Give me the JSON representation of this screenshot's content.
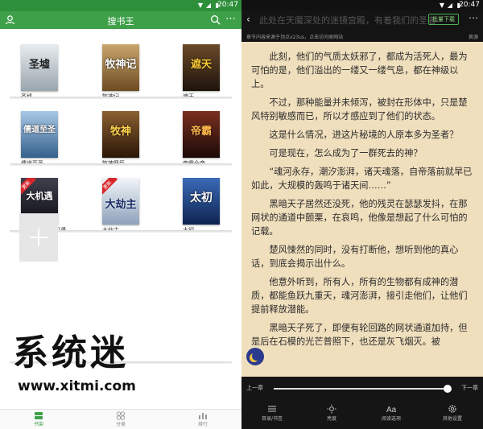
{
  "status": {
    "time": "20:47"
  },
  "left": {
    "app_title": "搜书王",
    "books": [
      {
        "name": "圣墟",
        "cover_title": "圣墟",
        "color": "#cfd6dc",
        "badge": ""
      },
      {
        "name": "牧神记",
        "cover_title": "牧神记",
        "color": "#8a6b3c",
        "badge": ""
      },
      {
        "name": "遮天",
        "cover_title": "遮天",
        "color": "#3a2a1a",
        "badge": ""
      },
      {
        "name": "儒道至圣",
        "cover_title": "儒道至圣",
        "color": "#5f8fb8",
        "badge": ""
      },
      {
        "name": "牧神祭臣",
        "cover_title": "牧神",
        "color": "#5a3a1e",
        "badge": ""
      },
      {
        "name": "帝霸全帝",
        "cover_title": "帝霸",
        "color": "#3b1e14",
        "badge": ""
      },
      {
        "name": "一念一首之大机遇",
        "cover_title": "大机遇",
        "color": "#1a1a22",
        "badge": "更新"
      },
      {
        "name": "大劫主",
        "cover_title": "大劫主",
        "color": "#dfe6ef",
        "badge": "更新"
      },
      {
        "name": "太初",
        "cover_title": "太初",
        "color": "#1c3f7c",
        "badge": ""
      }
    ],
    "watermark_big": "系统迷",
    "watermark_url": "www.xitmi.com",
    "nav": [
      {
        "label": "书架",
        "active": true
      },
      {
        "label": "分类",
        "active": false
      },
      {
        "label": "排行",
        "active": false
      }
    ]
  },
  "right": {
    "ghost_title": "此处在天魔深处的迷镜宫殿，有着我们的圣者",
    "download_label": "批量下载",
    "source_note": "章节内容来源于顶点x23us，点击访问原网站",
    "switch_label": "换源",
    "paragraphs": [
      "此刻，他们的气质太妖邪了，都成为活死人，最为可怕的是，他们溢出的一缕又一缕气息，都在神级以上。",
      "不过，那种能量并未倾泻，被封在形体中，只是楚风特别敏感而已，所以才感应到了他们的状态。",
      "这是什么情况，进这片秘境的人原本多为圣者？",
      "可是现在，怎么成为了一群死去的神？",
      "“魂河永存，潮汐澎湃，诸天魂落，自帝落前就早已如此，大规模的轰鸣于诸天间……”",
      "黑暗天子居然还没死，他的残灵在瑟瑟发抖，在那网状的通道中颤栗，在哀鸣，他像是想起了什么可怕的记载。",
      "楚风悚然的同时，没有打断他，想听到他的真心话，到底会揭示出什么。",
      "他意外听到，所有人，所有的生物都有成神的潜质，都能鱼跃九重天，魂河澎湃，接引走他们，让他们提前释放潜能。",
      "黑暗天子死了，即便有轮回路的网状通道加持，但是后在石模的光芒普照下，也还是灰飞烟灭。被"
    ],
    "prev_label": "上一章",
    "next_label": "下一章",
    "progress": 0.99,
    "tools": [
      {
        "label": "目录/书签"
      },
      {
        "label": "亮度"
      },
      {
        "label": "阅读选项"
      },
      {
        "label": "其他设置"
      }
    ]
  }
}
